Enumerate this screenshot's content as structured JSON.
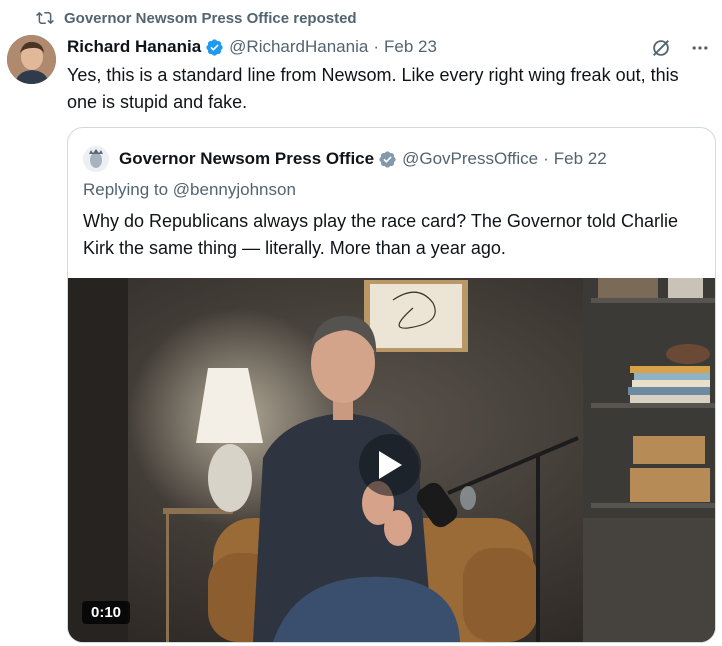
{
  "repost": {
    "text": "Governor Newsom Press Office reposted"
  },
  "post": {
    "author_name": "Richard Hanania",
    "handle": "@RichardHanania",
    "separator": "·",
    "date": "Feb 23",
    "text": "Yes, this is a standard line from Newsom. Like every right wing freak out, this one is stupid and fake."
  },
  "quote": {
    "author_name": "Governor Newsom Press Office",
    "handle": "@GovPressOffice",
    "separator": "·",
    "date": "Feb 22",
    "replying_to": "Replying to @bennyjohnson",
    "text": "Why do Republicans always play the race card? The Governor told Charlie Kirk the same thing — literally. More than a year ago.",
    "video": {
      "duration": "0:10"
    }
  },
  "colors": {
    "verified_blue": "#1d9bf0",
    "verified_gray": "#829aab",
    "muted_text": "#536471",
    "border": "#cfd9de"
  },
  "icons": [
    "repost-icon",
    "verified-badge-icon",
    "grok-icon",
    "more-icon",
    "play-icon"
  ]
}
